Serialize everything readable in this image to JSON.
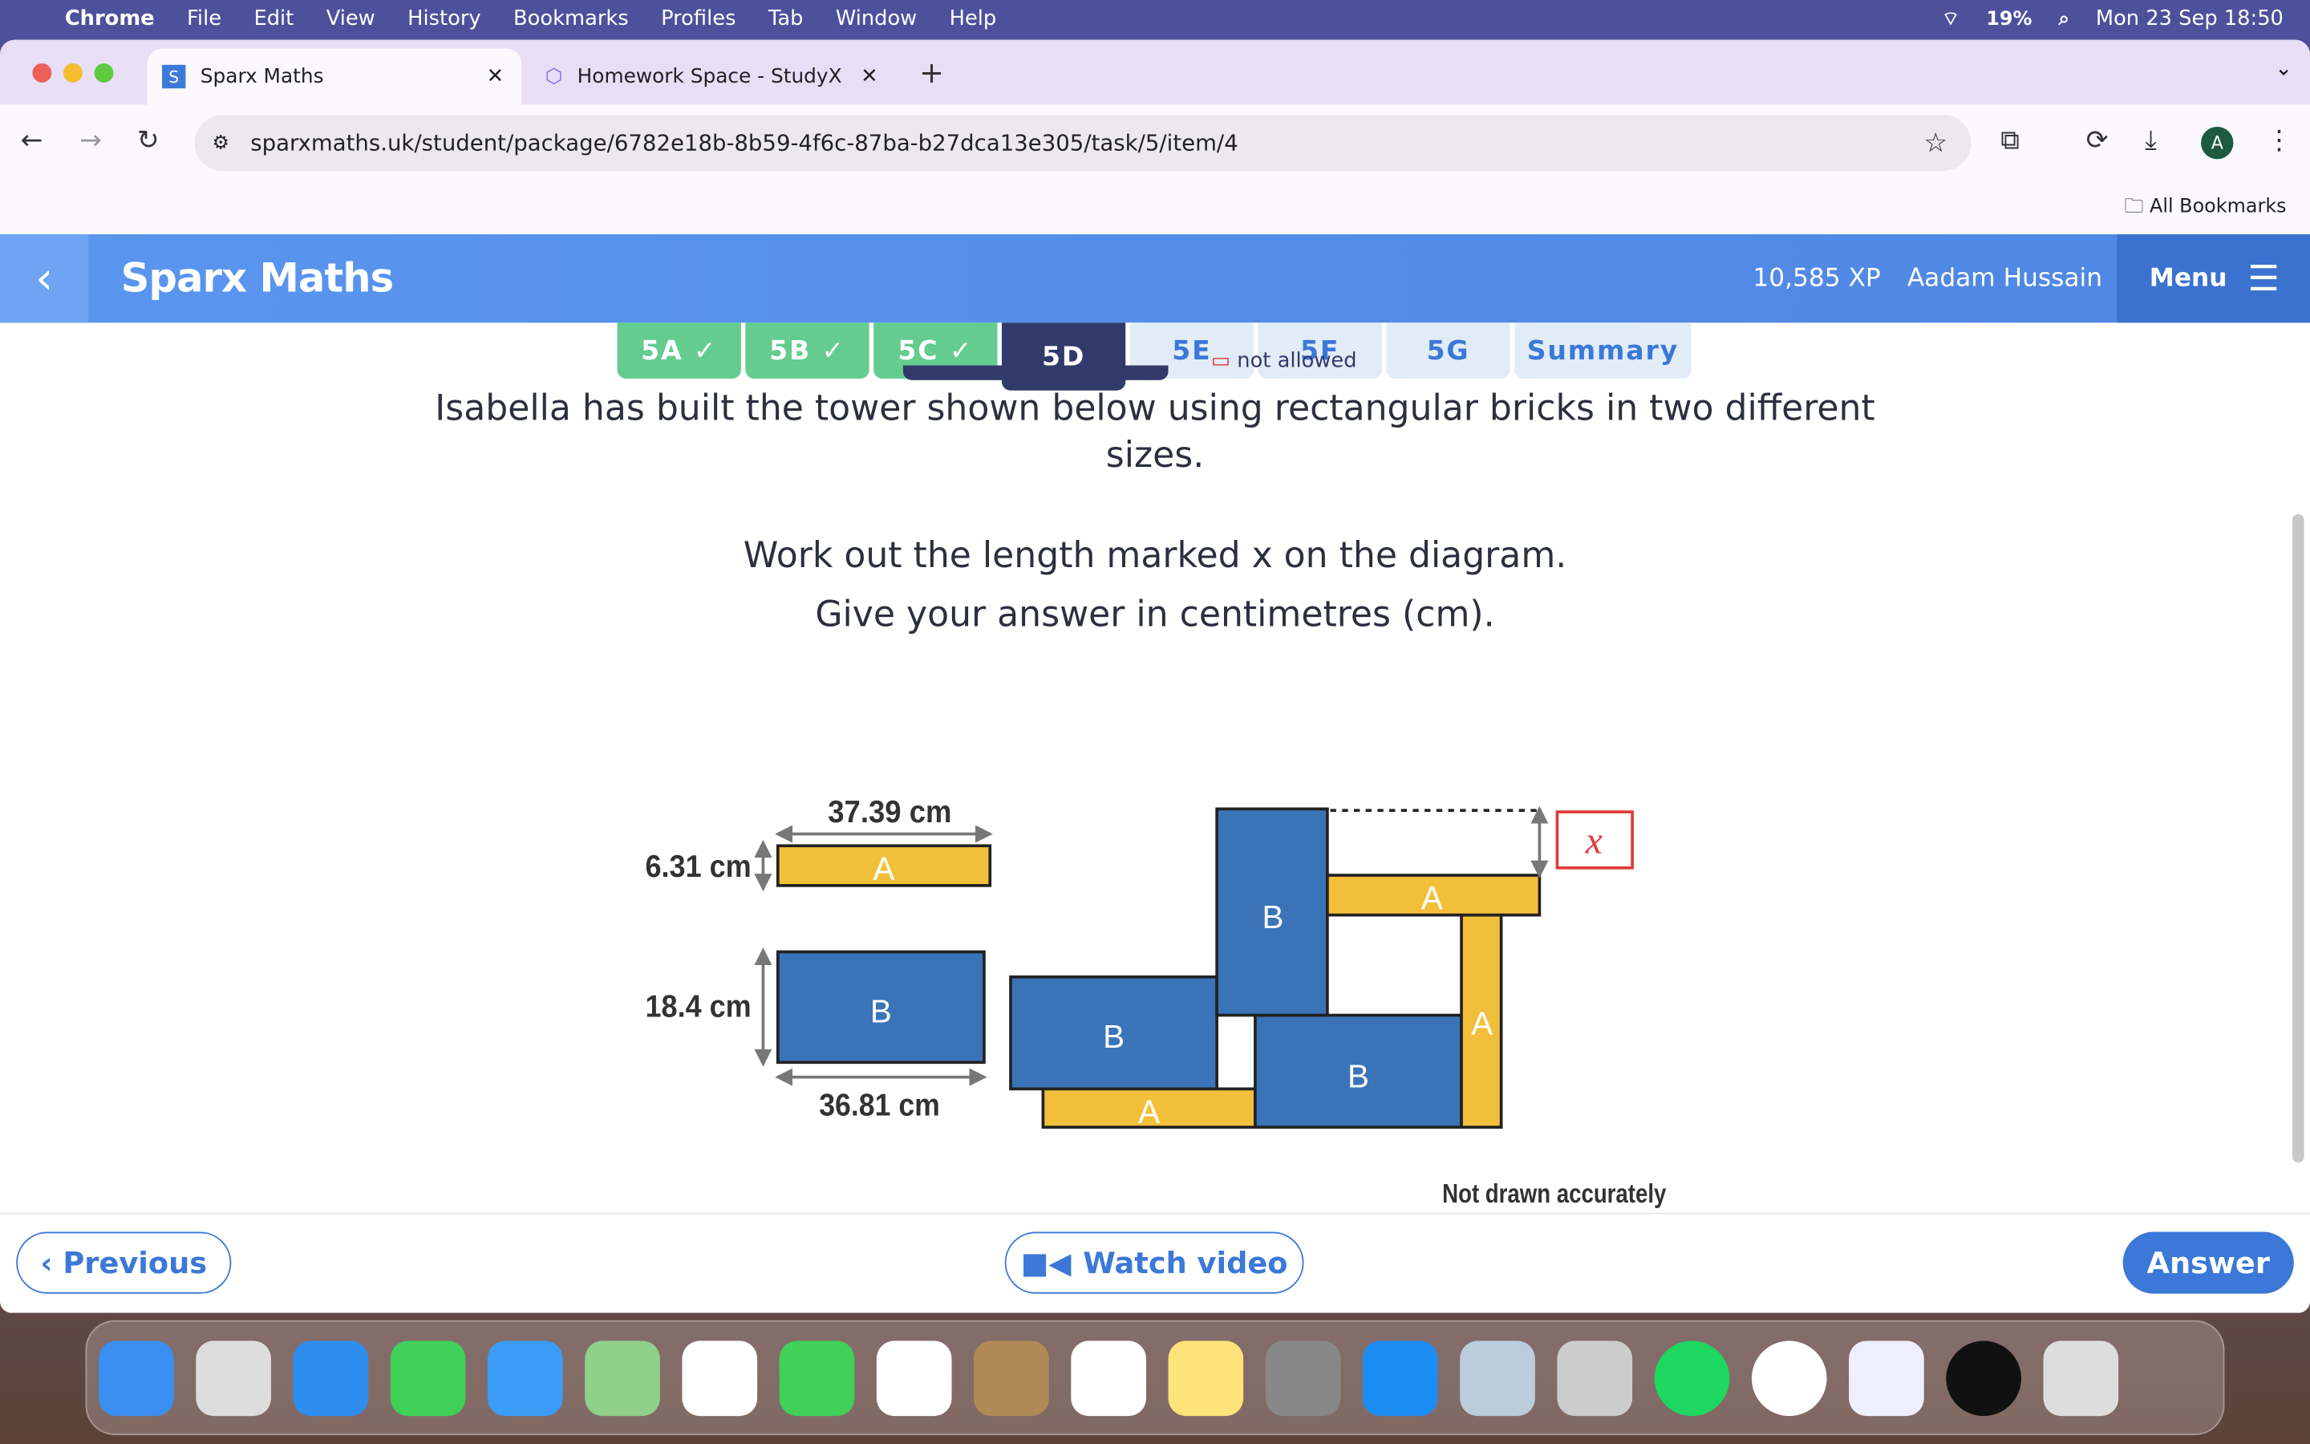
{
  "menubar": {
    "app": "Chrome",
    "items": [
      "File",
      "Edit",
      "View",
      "History",
      "Bookmarks",
      "Profiles",
      "Tab",
      "Window",
      "Help"
    ],
    "battery": "19%",
    "clock": "Mon 23 Sep  18:50"
  },
  "browser": {
    "tabs": [
      {
        "title": "Sparx Maths",
        "favicon": "S"
      },
      {
        "title": "Homework Space - StudyX"
      }
    ],
    "url": "sparxmaths.uk/student/package/6782e18b-8b59-4f6c-87ba-b27dca13e305/task/5/item/4",
    "bookmarks_label": "All Bookmarks",
    "profile": "A"
  },
  "app": {
    "brand": "Sparx Maths",
    "xp": "10,585 XP",
    "user": "Aadam Hussain",
    "menu": "Menu",
    "tasks": [
      {
        "label": "5A ✓",
        "state": "done"
      },
      {
        "label": "5B ✓",
        "state": "done"
      },
      {
        "label": "5C ✓",
        "state": "done"
      },
      {
        "label": "5D",
        "state": "current"
      },
      {
        "label": "5E",
        "state": "todo"
      },
      {
        "label": "5F",
        "state": "todo"
      },
      {
        "label": "5G",
        "state": "todo"
      },
      {
        "label": "Summary",
        "state": "todo"
      }
    ],
    "calculator_note": "not allowed",
    "question": {
      "line1": "Isabella has built the tower shown below using rectangular bricks in two different",
      "line2": "sizes.",
      "line3": "Work out the length marked x on the diagram.",
      "line4": "Give your answer in centimetres (cm)."
    },
    "diagram": {
      "brick_a": {
        "label": "A",
        "width": "37.39 cm",
        "height": "6.31 cm",
        "color": "#f2bf3a"
      },
      "brick_b": {
        "label": "B",
        "width": "36.81 cm",
        "height": "18.4 cm",
        "color": "#3a73b8"
      },
      "unknown": "x",
      "note": "Not drawn accurately"
    },
    "footer": {
      "previous": "Previous",
      "watch": "Watch video",
      "answer": "Answer"
    }
  }
}
